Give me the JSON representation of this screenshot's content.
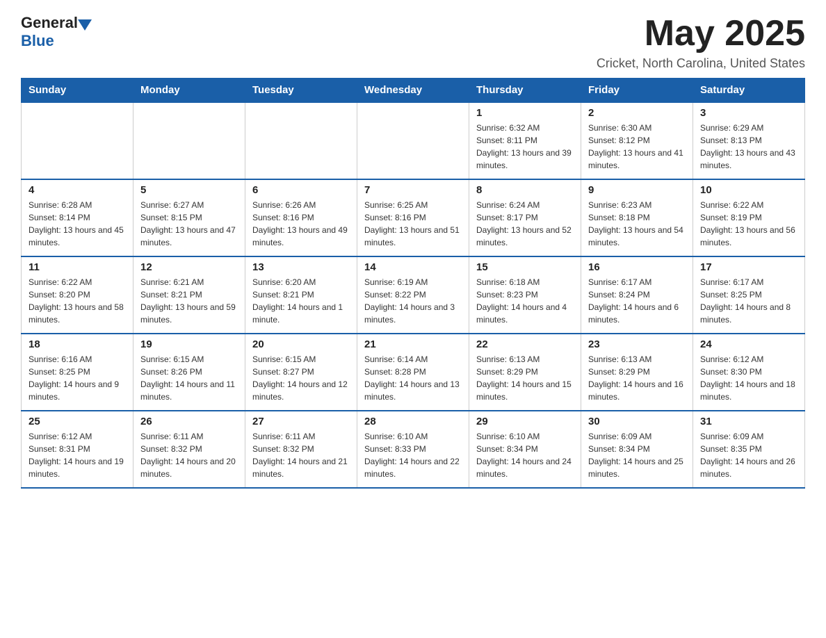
{
  "header": {
    "logo": {
      "general": "General",
      "blue": "Blue"
    },
    "title": "May 2025",
    "subtitle": "Cricket, North Carolina, United States"
  },
  "calendar": {
    "headers": [
      "Sunday",
      "Monday",
      "Tuesday",
      "Wednesday",
      "Thursday",
      "Friday",
      "Saturday"
    ],
    "weeks": [
      [
        {
          "day": "",
          "info": ""
        },
        {
          "day": "",
          "info": ""
        },
        {
          "day": "",
          "info": ""
        },
        {
          "day": "",
          "info": ""
        },
        {
          "day": "1",
          "info": "Sunrise: 6:32 AM\nSunset: 8:11 PM\nDaylight: 13 hours and 39 minutes."
        },
        {
          "day": "2",
          "info": "Sunrise: 6:30 AM\nSunset: 8:12 PM\nDaylight: 13 hours and 41 minutes."
        },
        {
          "day": "3",
          "info": "Sunrise: 6:29 AM\nSunset: 8:13 PM\nDaylight: 13 hours and 43 minutes."
        }
      ],
      [
        {
          "day": "4",
          "info": "Sunrise: 6:28 AM\nSunset: 8:14 PM\nDaylight: 13 hours and 45 minutes."
        },
        {
          "day": "5",
          "info": "Sunrise: 6:27 AM\nSunset: 8:15 PM\nDaylight: 13 hours and 47 minutes."
        },
        {
          "day": "6",
          "info": "Sunrise: 6:26 AM\nSunset: 8:16 PM\nDaylight: 13 hours and 49 minutes."
        },
        {
          "day": "7",
          "info": "Sunrise: 6:25 AM\nSunset: 8:16 PM\nDaylight: 13 hours and 51 minutes."
        },
        {
          "day": "8",
          "info": "Sunrise: 6:24 AM\nSunset: 8:17 PM\nDaylight: 13 hours and 52 minutes."
        },
        {
          "day": "9",
          "info": "Sunrise: 6:23 AM\nSunset: 8:18 PM\nDaylight: 13 hours and 54 minutes."
        },
        {
          "day": "10",
          "info": "Sunrise: 6:22 AM\nSunset: 8:19 PM\nDaylight: 13 hours and 56 minutes."
        }
      ],
      [
        {
          "day": "11",
          "info": "Sunrise: 6:22 AM\nSunset: 8:20 PM\nDaylight: 13 hours and 58 minutes."
        },
        {
          "day": "12",
          "info": "Sunrise: 6:21 AM\nSunset: 8:21 PM\nDaylight: 13 hours and 59 minutes."
        },
        {
          "day": "13",
          "info": "Sunrise: 6:20 AM\nSunset: 8:21 PM\nDaylight: 14 hours and 1 minute."
        },
        {
          "day": "14",
          "info": "Sunrise: 6:19 AM\nSunset: 8:22 PM\nDaylight: 14 hours and 3 minutes."
        },
        {
          "day": "15",
          "info": "Sunrise: 6:18 AM\nSunset: 8:23 PM\nDaylight: 14 hours and 4 minutes."
        },
        {
          "day": "16",
          "info": "Sunrise: 6:17 AM\nSunset: 8:24 PM\nDaylight: 14 hours and 6 minutes."
        },
        {
          "day": "17",
          "info": "Sunrise: 6:17 AM\nSunset: 8:25 PM\nDaylight: 14 hours and 8 minutes."
        }
      ],
      [
        {
          "day": "18",
          "info": "Sunrise: 6:16 AM\nSunset: 8:25 PM\nDaylight: 14 hours and 9 minutes."
        },
        {
          "day": "19",
          "info": "Sunrise: 6:15 AM\nSunset: 8:26 PM\nDaylight: 14 hours and 11 minutes."
        },
        {
          "day": "20",
          "info": "Sunrise: 6:15 AM\nSunset: 8:27 PM\nDaylight: 14 hours and 12 minutes."
        },
        {
          "day": "21",
          "info": "Sunrise: 6:14 AM\nSunset: 8:28 PM\nDaylight: 14 hours and 13 minutes."
        },
        {
          "day": "22",
          "info": "Sunrise: 6:13 AM\nSunset: 8:29 PM\nDaylight: 14 hours and 15 minutes."
        },
        {
          "day": "23",
          "info": "Sunrise: 6:13 AM\nSunset: 8:29 PM\nDaylight: 14 hours and 16 minutes."
        },
        {
          "day": "24",
          "info": "Sunrise: 6:12 AM\nSunset: 8:30 PM\nDaylight: 14 hours and 18 minutes."
        }
      ],
      [
        {
          "day": "25",
          "info": "Sunrise: 6:12 AM\nSunset: 8:31 PM\nDaylight: 14 hours and 19 minutes."
        },
        {
          "day": "26",
          "info": "Sunrise: 6:11 AM\nSunset: 8:32 PM\nDaylight: 14 hours and 20 minutes."
        },
        {
          "day": "27",
          "info": "Sunrise: 6:11 AM\nSunset: 8:32 PM\nDaylight: 14 hours and 21 minutes."
        },
        {
          "day": "28",
          "info": "Sunrise: 6:10 AM\nSunset: 8:33 PM\nDaylight: 14 hours and 22 minutes."
        },
        {
          "day": "29",
          "info": "Sunrise: 6:10 AM\nSunset: 8:34 PM\nDaylight: 14 hours and 24 minutes."
        },
        {
          "day": "30",
          "info": "Sunrise: 6:09 AM\nSunset: 8:34 PM\nDaylight: 14 hours and 25 minutes."
        },
        {
          "day": "31",
          "info": "Sunrise: 6:09 AM\nSunset: 8:35 PM\nDaylight: 14 hours and 26 minutes."
        }
      ]
    ]
  }
}
